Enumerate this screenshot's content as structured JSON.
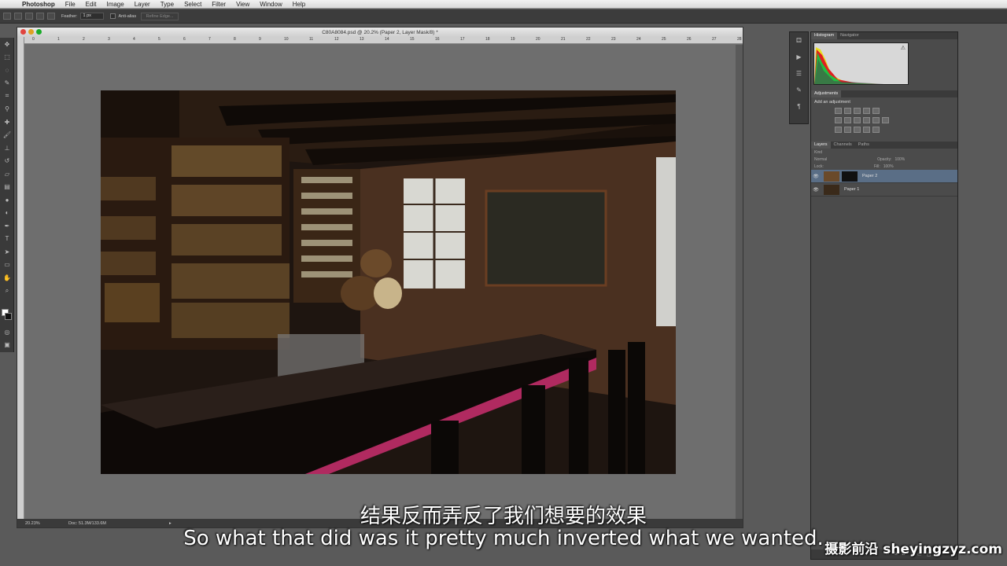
{
  "menubar": {
    "app": "Photoshop",
    "items": [
      "File",
      "Edit",
      "Image",
      "Layer",
      "Type",
      "Select",
      "Filter",
      "View",
      "Window",
      "Help"
    ]
  },
  "options": {
    "feather_label": "Feather:",
    "feather_value": "1 px",
    "antialias_label": "Anti-alias",
    "refine_label": "Refine Edge..."
  },
  "document": {
    "title": "C80A8084.psd @ 20.2% (Paper 2, Layer Mask/8) *",
    "zoom": "20.23%",
    "doc_info": "Doc: 51.3M/133.6M",
    "ruler_ticks": [
      "0",
      "1",
      "2",
      "3",
      "4",
      "5",
      "6",
      "7",
      "8",
      "9",
      "10",
      "11",
      "12",
      "13",
      "14",
      "15",
      "16",
      "17",
      "18",
      "19",
      "20",
      "21",
      "22",
      "23",
      "24",
      "25",
      "26",
      "27",
      "28"
    ]
  },
  "panels": {
    "histogram_tab": "Histogram",
    "navigator_tab": "Navigator",
    "adjustments_tab": "Adjustments",
    "add_adjustment": "Add an adjustment",
    "layers_tab": "Layers",
    "channels_tab": "Channels",
    "paths_tab": "Paths",
    "kind_label": "Kind",
    "blend_mode": "Normal",
    "opacity_label": "Opacity:",
    "opacity_value": "100%",
    "lock_label": "Lock:",
    "fill_label": "Fill:",
    "fill_value": "100%",
    "layers": [
      {
        "name": "Paper 2",
        "selected": true
      },
      {
        "name": "Paper 1",
        "selected": false
      }
    ]
  },
  "subtitles": {
    "chinese": "结果反而弄反了我们想要的效果",
    "english": "So what that did was it pretty much inverted what we wanted."
  },
  "watermark": "摄影前沿 sheyingzyz.com"
}
